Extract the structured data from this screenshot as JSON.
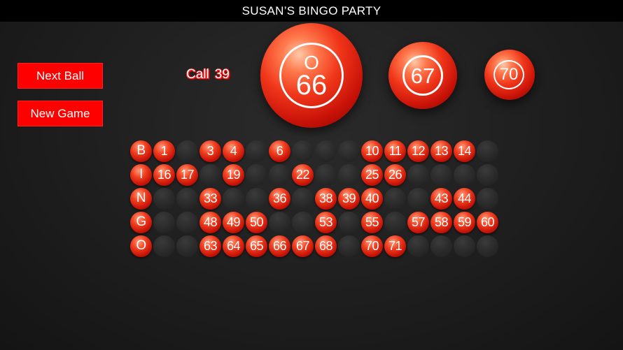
{
  "app": {
    "title": "SUSAN’S BINGO PARTY"
  },
  "buttons": {
    "next_ball": "Next Ball",
    "new_game": "New Game"
  },
  "call": {
    "label": "Call",
    "count": "39"
  },
  "current_ball": {
    "letter": "O",
    "number": "66"
  },
  "previous_balls": [
    "67",
    "70"
  ],
  "board": {
    "rows": [
      {
        "letter": "B",
        "called": [
          1,
          3,
          4,
          6,
          10,
          11,
          12,
          13,
          14
        ]
      },
      {
        "letter": "I",
        "called": [
          16,
          17,
          19,
          22,
          25,
          26
        ]
      },
      {
        "letter": "N",
        "called": [
          33,
          36,
          38,
          39,
          40,
          43,
          44
        ]
      },
      {
        "letter": "G",
        "called": [
          48,
          49,
          50,
          53,
          55,
          57,
          58,
          59,
          60
        ]
      },
      {
        "letter": "O",
        "called": [
          63,
          64,
          65,
          66,
          67,
          68,
          70,
          71
        ]
      }
    ],
    "start_numbers": [
      1,
      16,
      31,
      46,
      61
    ]
  },
  "colors": {
    "accent": "#ff0000",
    "ball": "#e02a10",
    "titlebar": "#000000"
  }
}
